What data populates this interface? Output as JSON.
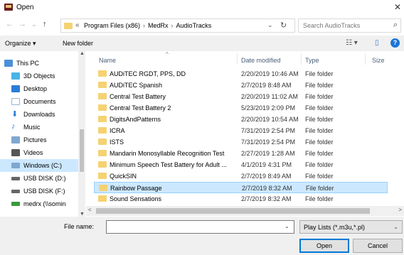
{
  "window": {
    "title": "Open",
    "close_glyph": "✕"
  },
  "nav": {
    "back": "←",
    "forward": "→",
    "recent": "⌄",
    "up": "↑",
    "breadcrumb_overflow": "«",
    "crumbs": [
      "Program Files (x86)",
      "MedRx",
      "AudioTracks"
    ],
    "crumb_separator": "›",
    "address_dropdown": "⌄",
    "refresh": "↻"
  },
  "search": {
    "placeholder": "Search AudioTracks",
    "icon": "⌕"
  },
  "toolbar": {
    "organize": "Organize ▾",
    "new_folder": "New folder",
    "view_icon": "☷ ▾",
    "pane_icon": "▯",
    "help": "?"
  },
  "sidebar": {
    "items": [
      {
        "label": "This PC",
        "icon": "computer-icon",
        "color": "#4a90d9"
      },
      {
        "label": "3D Objects",
        "icon": "cube-icon",
        "color": "#4ab4e8"
      },
      {
        "label": "Desktop",
        "icon": "desktop-icon",
        "color": "#2c7cd6"
      },
      {
        "label": "Documents",
        "icon": "document-icon",
        "color": "#9db4cc"
      },
      {
        "label": "Downloads",
        "icon": "download-icon",
        "color": "#2c7cd6"
      },
      {
        "label": "Music",
        "icon": "music-icon",
        "color": "#2c7cd6"
      },
      {
        "label": "Pictures",
        "icon": "pictures-icon",
        "color": "#7fa7cf"
      },
      {
        "label": "Videos",
        "icon": "videos-icon",
        "color": "#555555"
      },
      {
        "label": "Windows (C:)",
        "icon": "drive-icon",
        "color": "#7fa7cf"
      },
      {
        "label": "USB DISK (D:)",
        "icon": "usb-drive-icon",
        "color": "#666666"
      },
      {
        "label": "USB DISK (F:)",
        "icon": "usb-drive-icon",
        "color": "#666666"
      },
      {
        "label": "medrx (\\\\somin",
        "icon": "network-drive-icon",
        "color": "#3a9b3a"
      }
    ]
  },
  "columns": {
    "name": "Name",
    "date": "Date modified",
    "type": "Type",
    "size": "Size",
    "sort_indicator": "^"
  },
  "files": [
    {
      "name": "AUDiTEC RGDT, PPS, DD",
      "date": "2/20/2019 10:46 AM",
      "type": "File folder"
    },
    {
      "name": "AUDiTEC Spanish",
      "date": "2/7/2019 8:48 AM",
      "type": "File folder"
    },
    {
      "name": "Central Test Battery",
      "date": "2/20/2019 11:02 AM",
      "type": "File folder"
    },
    {
      "name": "Central Test Battery 2",
      "date": "5/23/2019 2:09 PM",
      "type": "File folder"
    },
    {
      "name": "DigitsAndPatterns",
      "date": "2/20/2019 10:54 AM",
      "type": "File folder"
    },
    {
      "name": "ICRA",
      "date": "7/31/2019 2:54 PM",
      "type": "File folder"
    },
    {
      "name": "ISTS",
      "date": "7/31/2019 2:54 PM",
      "type": "File folder"
    },
    {
      "name": "Mandarin Monosyllable Recognition Test",
      "date": "2/27/2019 1:28 AM",
      "type": "File folder"
    },
    {
      "name": "Minimum Speech Test Battery for Adult ...",
      "date": "4/1/2019 4:31 PM",
      "type": "File folder"
    },
    {
      "name": "QuickSIN",
      "date": "2/7/2019 8:49 AM",
      "type": "File folder"
    },
    {
      "name": "Rainbow Passage",
      "date": "2/7/2019 8:32 AM",
      "type": "File folder",
      "selected": true
    },
    {
      "name": "Sound Sensations",
      "date": "2/7/2019 8:32 AM",
      "type": "File folder"
    }
  ],
  "scroll": {
    "up": "▲",
    "down": "▼",
    "left": "<",
    "right": ">"
  },
  "footer": {
    "filename_label": "File name:",
    "filename_value": "",
    "filename_dropdown": "⌄",
    "filetype": "Play Lists (*.m3u,*.pl)",
    "filetype_caret": "⌄",
    "open": "Open",
    "cancel": "Cancel"
  },
  "colors": {
    "accent": "#0078d7",
    "selection": "#cce8ff",
    "folder": "#f5d272",
    "header_text": "#4c607a"
  }
}
